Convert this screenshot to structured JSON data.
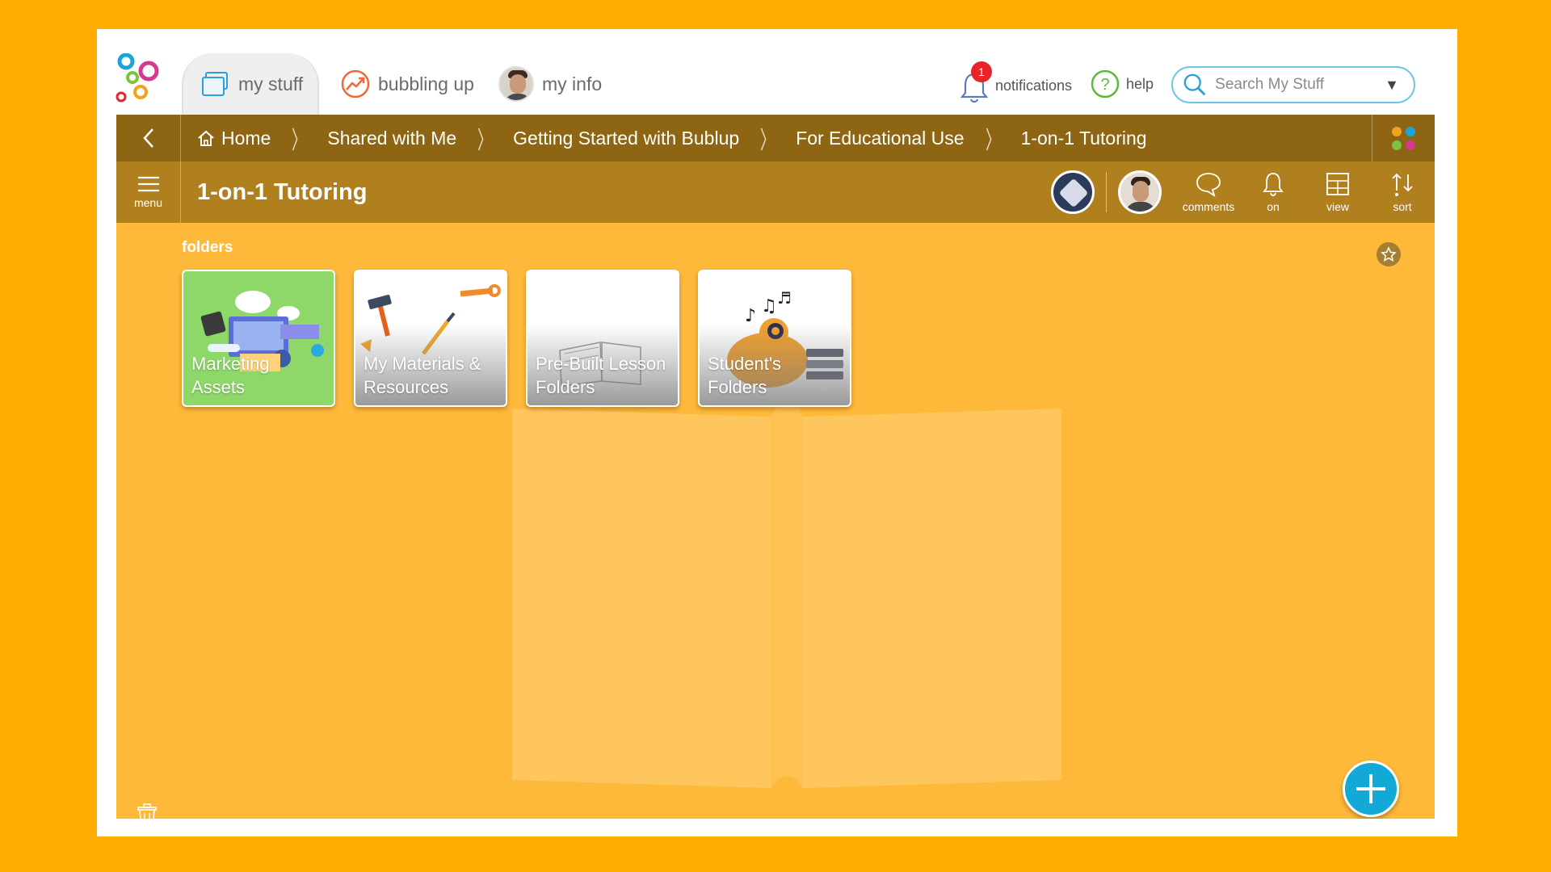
{
  "nav": {
    "tabs": [
      {
        "label": "my stuff",
        "icon": "folders-icon"
      },
      {
        "label": "bubbling up",
        "icon": "trending-icon"
      },
      {
        "label": "my info",
        "icon": "avatar"
      }
    ],
    "notifications_label": "notifications",
    "notifications_count": "1",
    "help_label": "help",
    "search_placeholder": "Search My Stuff",
    "search_caret": "▼"
  },
  "breadcrumb": [
    "Home",
    "Shared with Me",
    "Getting Started with Bublup",
    "For Educational Use",
    "1-on-1 Tutoring"
  ],
  "titlebar": {
    "menu_label": "menu",
    "title": "1-on-1 Tutoring",
    "tools": {
      "comments": "comments",
      "notify": "on",
      "view": "view",
      "sort": "sort"
    }
  },
  "content": {
    "section_label": "folders",
    "folders": [
      {
        "line1": "Marketing",
        "line2": "Assets"
      },
      {
        "line1": "My Materials &",
        "line2": "Resources"
      },
      {
        "line1": "Pre-Built Lesson",
        "line2": "Folders"
      },
      {
        "line1": "Student's",
        "line2": "Folders"
      }
    ]
  },
  "colors": {
    "page_bg": "#FFAE00",
    "crumb_bar": "#8E6512",
    "title_bar": "#B07F1E",
    "content_bg": "#FFB93A",
    "fab": "#12a9d6",
    "badge": "#e8242a"
  }
}
